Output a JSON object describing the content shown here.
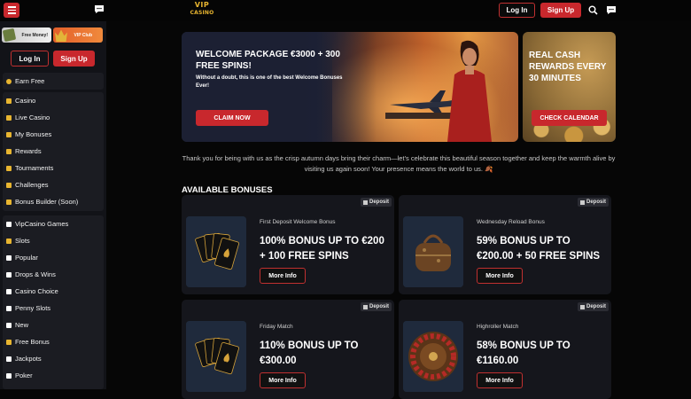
{
  "header": {
    "logo_line1": "VIP",
    "logo_line2": "CASINO",
    "login_label": "Log In",
    "signup_label": "Sign Up"
  },
  "sidebar": {
    "promo_free_money": "Free Money!",
    "promo_vip_club": "VIP Club",
    "login_label": "Log In",
    "signup_label": "Sign Up",
    "earn_free": "Earn Free",
    "group1": [
      {
        "label": "Casino",
        "icon": "seven-icon"
      },
      {
        "label": "Live Casino",
        "icon": "cards-icon"
      },
      {
        "label": "My Bonuses",
        "icon": "gift-icon"
      },
      {
        "label": "Rewards",
        "icon": "trophy-icon"
      },
      {
        "label": "Tournaments",
        "icon": "flag-icon"
      },
      {
        "label": "Challenges",
        "icon": "target-icon"
      },
      {
        "label": "Bonus Builder (Soon)",
        "icon": "bag-icon"
      }
    ],
    "group2": [
      {
        "label": "VipCasino Games",
        "icon": "star-icon"
      },
      {
        "label": "Slots",
        "icon": "seven-icon"
      },
      {
        "label": "Popular",
        "icon": "fire-icon"
      },
      {
        "label": "Drops & Wins",
        "icon": "drop-icon"
      },
      {
        "label": "Casino Choice",
        "icon": "crown-icon"
      },
      {
        "label": "Penny Slots",
        "icon": "coin-icon"
      },
      {
        "label": "New",
        "icon": "new-icon"
      },
      {
        "label": "Free Bonus",
        "icon": "gift-icon"
      },
      {
        "label": "Jackpots",
        "icon": "diamond-icon"
      },
      {
        "label": "Poker",
        "icon": "chip-icon"
      }
    ]
  },
  "banner_main": {
    "title": "WELCOME PACKAGE €3000 + 300 FREE SPINS!",
    "subtitle": "Without a doubt, this is one of the best Welcome Bonuses Ever!",
    "cta": "CLAIM NOW"
  },
  "banner_cash": {
    "title": "REAL CASH REWARDS EVERY 30 MINUTES",
    "cta": "CHECK CALENDAR"
  },
  "thanks_text": "Thank you for being with us as the crisp autumn days bring their charm—let's celebrate this beautiful season together and keep the warmth alive by visiting us again soon! Your presence means the world to us. 🍂",
  "bonuses_title": "AVAILABLE BONUSES",
  "bonuses": [
    {
      "badge": "Deposit",
      "title": "First Deposit Welcome Bonus",
      "line1": "100% BONUS UP TO €200",
      "line2": "+ 100 FREE SPINS",
      "more": "More Info",
      "image": "cards"
    },
    {
      "badge": "Deposit",
      "title": "Wednesday Reload Bonus",
      "line1": "59% BONUS UP TO",
      "line2": "€200.00 + 50 FREE SPINS",
      "more": "More Info",
      "image": "bag"
    },
    {
      "badge": "Deposit",
      "title": "Friday Match",
      "line1": "110% BONUS UP TO",
      "line2": "€300.00",
      "more": "More Info",
      "image": "cards"
    },
    {
      "badge": "Deposit",
      "title": "Highroller Match",
      "line1": "58% BONUS UP TO",
      "line2": "€1160.00",
      "more": "More Info",
      "image": "roulette"
    }
  ],
  "colors": {
    "accent": "#c8282d",
    "gold": "#e8b530"
  }
}
